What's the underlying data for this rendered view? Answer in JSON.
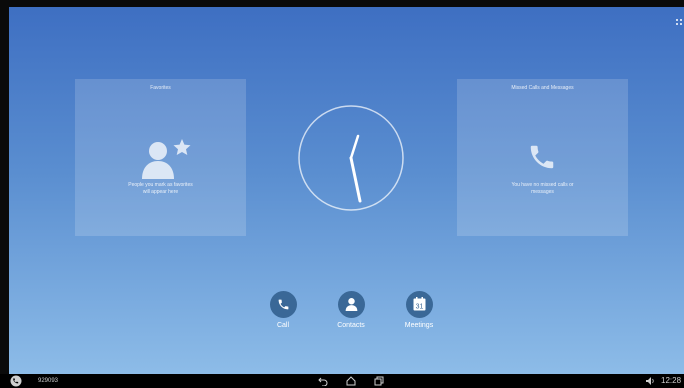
{
  "favorites": {
    "title": "Favorites",
    "empty_text_line1": "People you mark as favorites",
    "empty_text_line2": "will appear here",
    "icon": "person-star-icon"
  },
  "missed": {
    "title": "Missed Calls and Messages",
    "empty_text_line1": "You have no missed calls or",
    "empty_text_line2": "messages",
    "icon": "phone-icon"
  },
  "actions": {
    "call": {
      "label": "Call",
      "icon": "phone-icon"
    },
    "contacts": {
      "label": "Contacts",
      "icon": "person-icon"
    },
    "meetings": {
      "label": "Meetings",
      "icon": "calendar-icon",
      "day": "31"
    }
  },
  "clock": {
    "time": "12:28",
    "style": "analog"
  },
  "taskbar": {
    "number": "929093",
    "time": "12:28",
    "icons": [
      "phone-icon",
      "back-icon",
      "home-icon",
      "recents-icon",
      "volume-icon"
    ]
  },
  "colors": {
    "background_top": "#3e6fc2",
    "background_bottom": "#8dbce8",
    "action_circle": "#3a6897",
    "taskbar": "#000000"
  }
}
